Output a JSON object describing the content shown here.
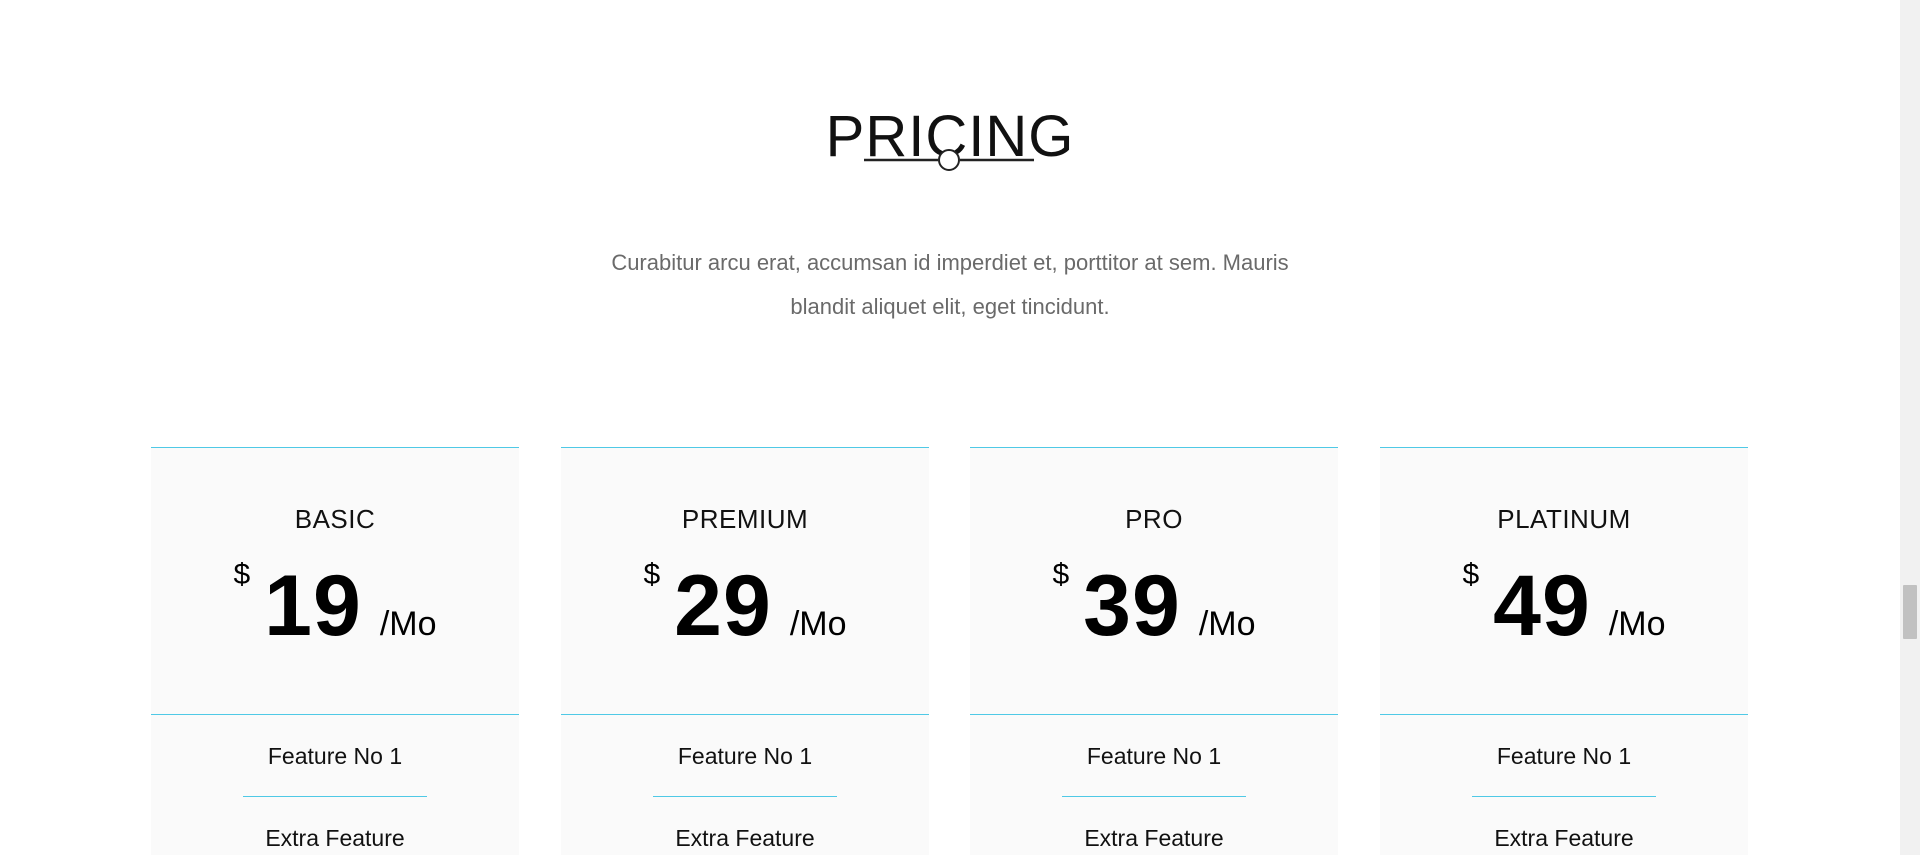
{
  "section": {
    "title": "PRICING",
    "intro_line1": "Curabitur arcu erat, accumsan id imperdiet et, porttitor at sem. Mauris",
    "intro_line2": "blandit aliquet elit, eget tincidunt."
  },
  "colors": {
    "accent": "#4fc9e6",
    "card_background": "#fafafa",
    "text_muted": "#6a6a6a"
  },
  "plans": [
    {
      "name": "BASIC",
      "currency": "$",
      "amount": "19",
      "period": "/Mo",
      "features": [
        "Feature No 1",
        "Extra Feature"
      ]
    },
    {
      "name": "PREMIUM",
      "currency": "$",
      "amount": "29",
      "period": "/Mo",
      "features": [
        "Feature No 1",
        "Extra Feature"
      ]
    },
    {
      "name": "PRO",
      "currency": "$",
      "amount": "39",
      "period": "/Mo",
      "features": [
        "Feature No 1",
        "Extra Feature"
      ]
    },
    {
      "name": "PLATINUM",
      "currency": "$",
      "amount": "49",
      "period": "/Mo",
      "features": [
        "Feature No 1",
        "Extra Feature"
      ]
    }
  ]
}
